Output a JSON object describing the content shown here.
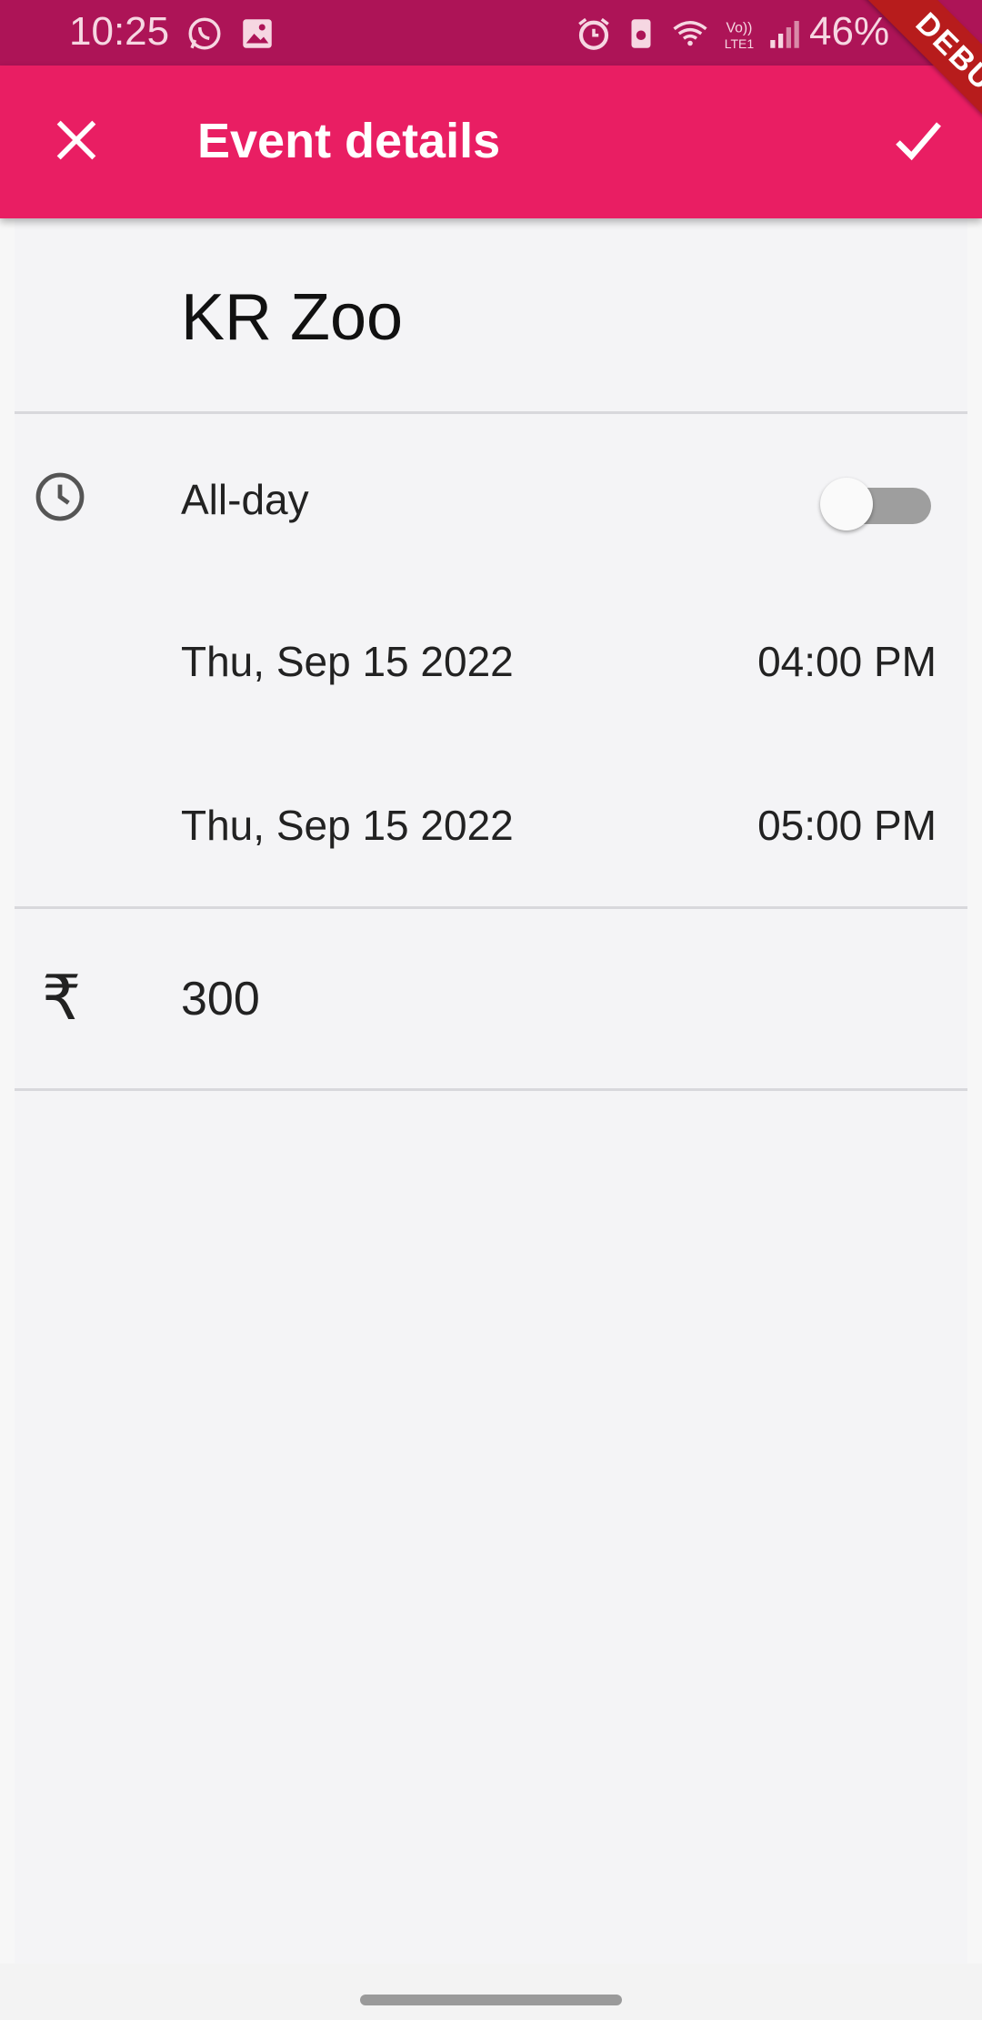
{
  "status_bar": {
    "time": "10:25",
    "battery": "46%",
    "icons": [
      "whatsapp-icon",
      "gallery-icon",
      "alarm-icon",
      "battery-saver-icon",
      "wifi-icon",
      "volte-icon",
      "signal-icon"
    ]
  },
  "app_bar": {
    "title": "Event details",
    "close_icon": "close-icon",
    "confirm_icon": "check-icon",
    "color": "#e91e63"
  },
  "debug_banner": "DEBUG",
  "event": {
    "title": "KR Zoo",
    "all_day_label": "All-day",
    "all_day": false,
    "start_date": "Thu, Sep 15 2022",
    "start_time": "04:00 PM",
    "end_date": "Thu, Sep 15 2022",
    "end_time": "05:00 PM",
    "price": "300",
    "price_symbol": "₹"
  }
}
